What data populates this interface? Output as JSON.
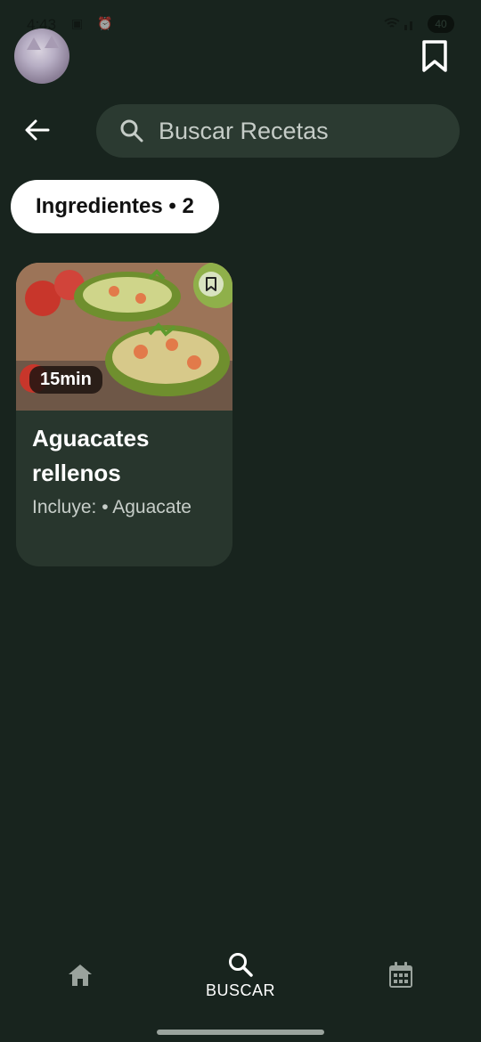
{
  "status_bar": {
    "time": "4:43",
    "battery": "40"
  },
  "header": {
    "search_placeholder": "Buscar Recetas"
  },
  "filter_chip": {
    "label": "Ingredientes • 2"
  },
  "results": [
    {
      "title": "Aguacates rellenos",
      "time": "15min",
      "subtitle": "Incluye: • Aguacate"
    }
  ],
  "bottom_nav": {
    "items": [
      {
        "icon": "home-icon",
        "label": ""
      },
      {
        "icon": "search-icon",
        "label": "BUSCAR"
      },
      {
        "icon": "calendar-icon",
        "label": ""
      }
    ]
  },
  "colors": {
    "background": "#18241e",
    "card": "#28362d",
    "search_bar": "#2b3a31",
    "chip": "#ffffff"
  }
}
